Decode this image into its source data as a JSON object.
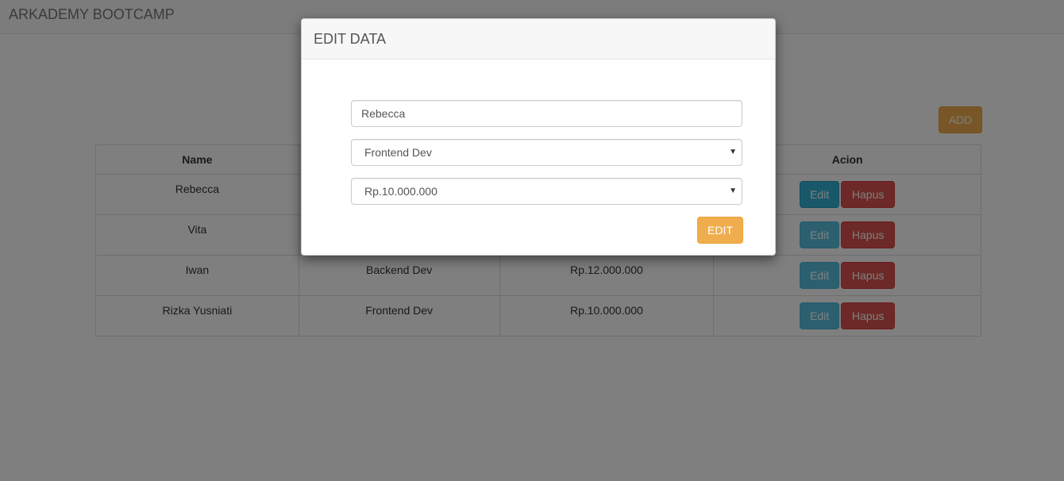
{
  "app": {
    "brand": "ARKADEMY BOOTCAMP"
  },
  "toolbar": {
    "add_label": "ADD"
  },
  "table": {
    "headers": [
      "Name",
      "",
      "",
      "Acion"
    ],
    "rows": [
      {
        "name": "Rebecca",
        "position": "",
        "salary": "",
        "edit_label": "Edit",
        "delete_label": "Hapus"
      },
      {
        "name": "Vita",
        "position": "",
        "salary": "",
        "edit_label": "Edit",
        "delete_label": "Hapus"
      },
      {
        "name": "Iwan",
        "position": "Backend Dev",
        "salary": "Rp.12.000.000",
        "edit_label": "Edit",
        "delete_label": "Hapus"
      },
      {
        "name": "Rizka Yusniati",
        "position": "Frontend Dev",
        "salary": "Rp.10.000.000",
        "edit_label": "Edit",
        "delete_label": "Hapus"
      }
    ]
  },
  "modal": {
    "title": "EDIT DATA",
    "name_value": "Rebecca",
    "position_value": "Frontend Dev",
    "salary_value": "Rp.10.000.000",
    "submit_label": "EDIT",
    "select_caret_icon": "caret-down-icon"
  },
  "colors": {
    "warning": "#f0ad4e",
    "info": "#5bc0de",
    "danger": "#d9534f"
  }
}
